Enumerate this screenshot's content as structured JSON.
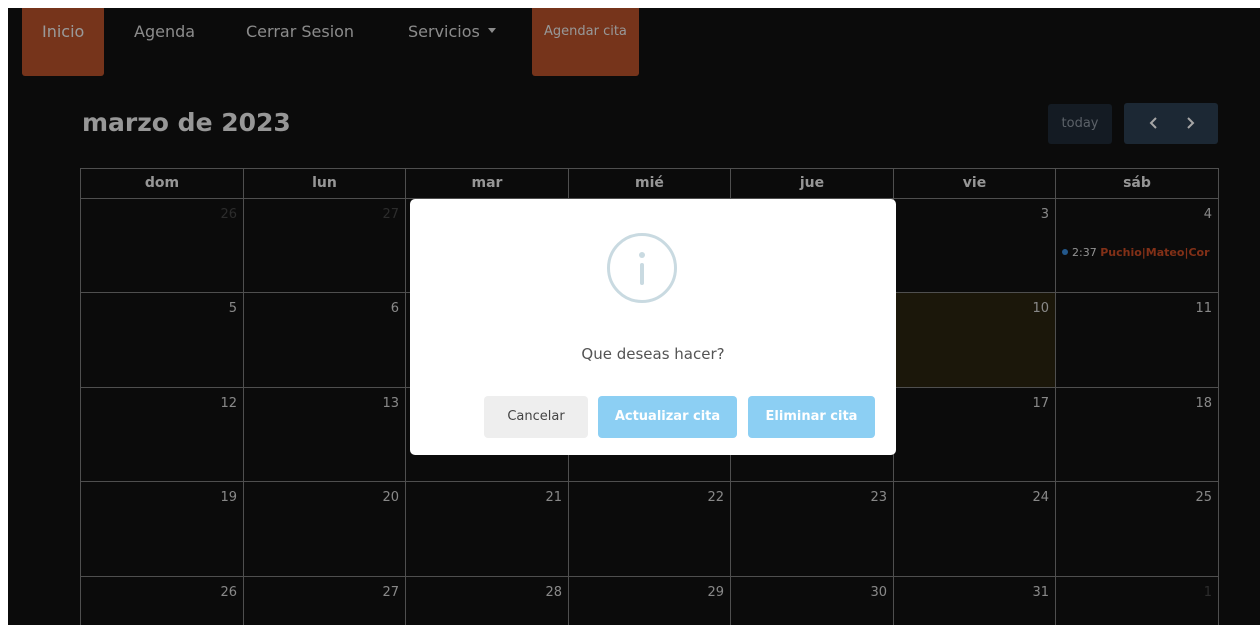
{
  "nav": {
    "inicio": "Inicio",
    "agenda": "Agenda",
    "cerrar_sesion": "Cerrar Sesion",
    "servicios": "Servicios",
    "agendar_cita": "Agendar cita"
  },
  "toolbar": {
    "title": "marzo de 2023",
    "today": "today"
  },
  "calendar": {
    "weekdays": [
      "dom",
      "lun",
      "mar",
      "mié",
      "jue",
      "vie",
      "sáb"
    ],
    "weeks": [
      [
        "26",
        "27",
        "",
        "",
        "",
        "3",
        "4"
      ],
      [
        "5",
        "6",
        "",
        "",
        "",
        "10",
        "11"
      ],
      [
        "12",
        "13",
        "",
        "",
        "",
        "17",
        "18"
      ],
      [
        "19",
        "20",
        "21",
        "22",
        "23",
        "24",
        "25"
      ],
      [
        "26",
        "27",
        "28",
        "29",
        "30",
        "31",
        "1"
      ]
    ],
    "event": {
      "time": "2:37",
      "title": "Puchio|Mateo|Cor"
    }
  },
  "modal": {
    "icon": "info-icon",
    "message": "Que deseas hacer?",
    "cancel": "Cancelar",
    "update": "Actualizar cita",
    "delete": "Eliminar cita"
  },
  "colors": {
    "accent": "#b5502a",
    "event_dot": "#3788d8",
    "button_blue": "#8ccff3",
    "today_bg": "#2a2410"
  }
}
